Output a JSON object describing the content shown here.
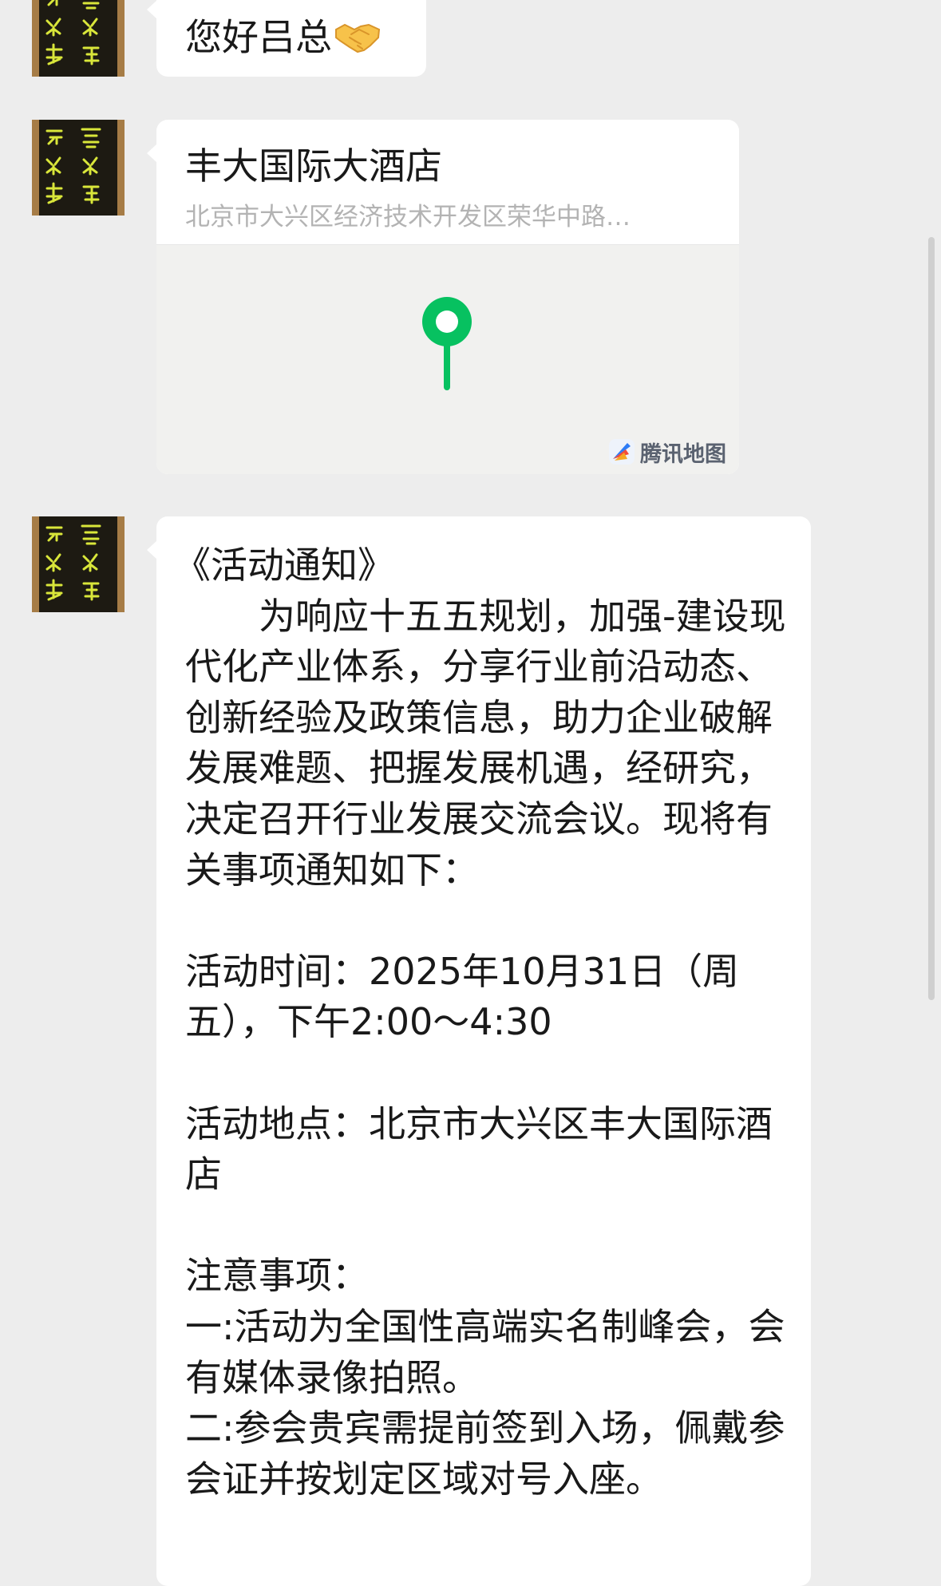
{
  "messages": [
    {
      "type": "text",
      "text": "您好吕总",
      "emoji": "handshake-emoji"
    },
    {
      "type": "location",
      "name": "丰大国际大酒店",
      "address": "北京市大兴区经济技术开发区荣华中路…",
      "map_provider": "腾讯地图"
    },
    {
      "type": "text",
      "title": "《活动通知》",
      "body": "　　为响应十五五规划，加强-建设现代化产业体系，分享行业前沿动态、创新经验及政策信息，助力企业破解发展难题、把握发展机遇，经研究，决定召开行业发展交流会议。现将有关事项通知如下：\n\n活动时间：2025年10月31日（周五），下午2:00～4:30\n\n活动地点：北京市大兴区丰大国际酒店\n\n注意事项：\n一:活动为全国性高端实名制峰会，会有媒体录像拍照。\n二:参会贵宾需提前签到入场，佩戴参会证并按划定区域对号入座。"
    }
  ],
  "colors": {
    "background": "#ededed",
    "bubble": "#ffffff",
    "pin": "#07c160",
    "address": "#b3b3b3",
    "avatar_text": "#d9e63a"
  }
}
